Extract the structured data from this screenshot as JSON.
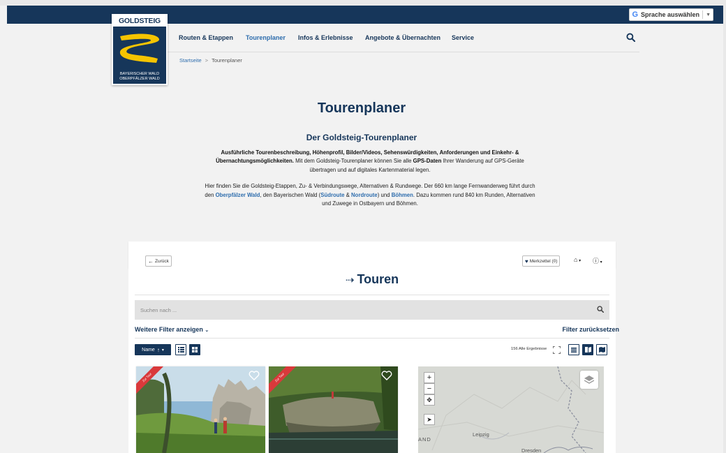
{
  "translate": {
    "label": "Sprache auswählen",
    "arrow": "▼"
  },
  "logo": {
    "title": "GOLDSTEIG",
    "sub1": "BAYERISCHER WALD",
    "sub2": "OBERPFÄLZER WALD"
  },
  "nav": {
    "items": [
      "Routen & Etappen",
      "Tourenplaner",
      "Infos & Erlebnisse",
      "Angebote & Übernachten",
      "Service"
    ],
    "active_index": 1
  },
  "breadcrumb": {
    "home": "Startseite",
    "separator": ">",
    "current": "Tourenplaner"
  },
  "page": {
    "title": "Tourenplaner",
    "subtitle": "Der Goldsteig-Tourenplaner",
    "p1_bold1": "Ausführliche Tourenbeschreibung, Höhenprofil, Bilder/Videos, Sehenswürdigkeiten, Anforderungen und Einkehr- & Übernachtungsmöglichkeiten.",
    "p1_text1": " Mit dem Goldsteig-Tourenplaner können Sie alle ",
    "p1_bold2": "GPS-Daten",
    "p1_text2": " Ihrer Wanderung auf GPS-Geräte übertragen und auf digitales Kartenmaterial legen.",
    "p2_text1": "Hier finden Sie die Goldsteig-Etappen, Zu- & Verbindungswege, Alternativen & Rundwege. Der 660 km lange Fernwanderweg führt durch den ",
    "p2_link1": "Oberpfälzer Wald",
    "p2_text2": ", den Bayerischen Wald (",
    "p2_link2": "Südroute",
    "p2_text3": " & ",
    "p2_link3": "Nordroute",
    "p2_text4": ") und ",
    "p2_link4": "Böhmen",
    "p2_text5": ". Dazu kommen rund 840 km Runden, Alternativen und Zuwege in Ostbayern und Böhmen."
  },
  "toolbar": {
    "back_label": "Zurück",
    "memo_label": "Merkzettel (0)"
  },
  "tours": {
    "title": "Touren",
    "search_placeholder": "Suchen nach ...",
    "more_filters": "Weitere Filter anzeigen",
    "reset_filters": "Filter zurücksetzen",
    "sort_label": "Name",
    "results_label": "156 Alle Ergebnisse"
  },
  "cards": [
    {
      "ribbon": "Zur Tour"
    },
    {
      "ribbon": "Zur Tour"
    }
  ],
  "map": {
    "labels": [
      "AND",
      "Leipzig",
      "Dresden"
    ],
    "zoom_in": "+",
    "zoom_out": "−"
  },
  "colors": {
    "brand_navy": "#16365a",
    "link_blue": "#2e6dad",
    "accent_yellow": "#f5c400",
    "ribbon_red": "#d9393b"
  }
}
